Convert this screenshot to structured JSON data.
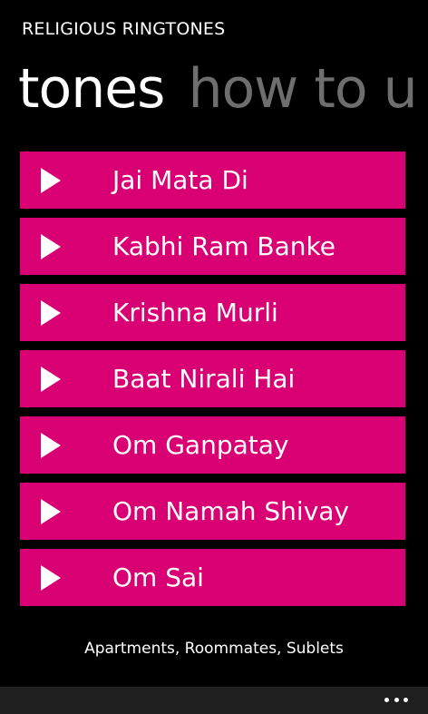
{
  "app": {
    "title": "RELIGIOUS RINGTONES"
  },
  "pivot": {
    "items": [
      {
        "label": "tones",
        "active": true
      },
      {
        "label": "how to u",
        "active": false
      }
    ]
  },
  "tones": {
    "items": [
      {
        "label": "Jai Mata Di",
        "icon": "play-icon"
      },
      {
        "label": "Kabhi Ram Banke",
        "icon": "play-icon"
      },
      {
        "label": "Krishna Murli",
        "icon": "play-icon"
      },
      {
        "label": "Baat Nirali Hai",
        "icon": "play-icon"
      },
      {
        "label": "Om Ganpatay",
        "icon": "play-icon"
      },
      {
        "label": "Om Namah Shivay",
        "icon": "play-icon"
      },
      {
        "label": "Om Sai",
        "icon": "play-icon"
      }
    ]
  },
  "ad": {
    "text": "Apartments, Roommates, Sublets"
  },
  "app_bar": {
    "more_icon": "ellipsis-icon"
  },
  "colors": {
    "accent": "#d80073",
    "background": "#000000",
    "inactive_header": "#6e6e6e",
    "app_bar": "#1f1f1f"
  }
}
